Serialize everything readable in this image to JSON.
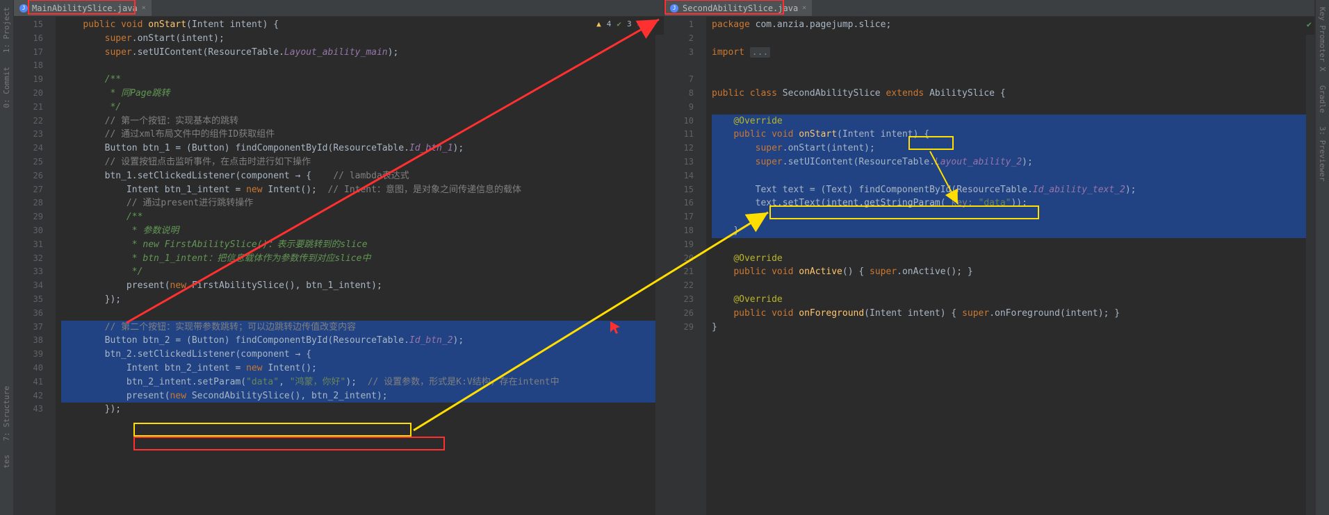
{
  "sidebar_left": {
    "project": "1: Project",
    "commit": "0: Commit"
  },
  "sidebar_left2": {
    "structure": "7: Structure",
    "tes": "tes"
  },
  "sidebar_right": {
    "keypromoter": "Key Promoter X",
    "gradle": "Gradle",
    "previewer": "3: Previewer"
  },
  "left_tab": "MainAbilitySlice.java",
  "right_tab": "SecondAbilitySlice.java",
  "inspections": {
    "warn": "4",
    "weak": "3"
  },
  "left_start_line": 15,
  "left_lines": [
    {
      "t": "    public void onStart(Intent intent) {",
      "tok": [
        [
          "    ",
          ""
        ],
        [
          "public",
          "kw"
        ],
        [
          " ",
          ""
        ],
        [
          "void",
          "kw"
        ],
        [
          " ",
          ""
        ],
        [
          "onStart",
          "mth"
        ],
        [
          "(Intent intent) {",
          ""
        ]
      ]
    },
    {
      "t": "        super.onStart(intent);",
      "tok": [
        [
          "        ",
          ""
        ],
        [
          "super",
          "kw"
        ],
        [
          ".onStart(intent);",
          ""
        ]
      ]
    },
    {
      "t": "        super.setUIContent(ResourceTable.Layout_ability_main);",
      "tok": [
        [
          "        ",
          ""
        ],
        [
          "super",
          "kw"
        ],
        [
          ".setUIContent(ResourceTable.",
          ""
        ],
        [
          "Layout_ability_main",
          "field"
        ],
        [
          ");",
          ""
        ]
      ]
    },
    {
      "t": ""
    },
    {
      "t": "        /**",
      "tok": [
        [
          "        ",
          ""
        ],
        [
          "/**",
          "doc"
        ]
      ]
    },
    {
      "t": "         * 同Page跳转",
      "tok": [
        [
          "         * 同Page跳转",
          "doc"
        ]
      ]
    },
    {
      "t": "         */",
      "tok": [
        [
          "         */",
          "doc"
        ]
      ]
    },
    {
      "t": "        // 第一个按钮：实现基本的跳转",
      "tok": [
        [
          "        ",
          ""
        ],
        [
          "// 第一个按钮：实现基本的跳转",
          "cmt"
        ]
      ]
    },
    {
      "t": "        // 通过xml布局文件中的组件ID获取组件",
      "tok": [
        [
          "        ",
          ""
        ],
        [
          "// 通过xml布局文件中的组件ID获取组件",
          "cmt"
        ]
      ]
    },
    {
      "t": "        Button btn_1 = (Button) findComponentById(ResourceTable.Id_btn_1);",
      "tok": [
        [
          "        Button btn_1 = (Button) findComponentById(ResourceTable.",
          ""
        ],
        [
          "Id_btn_1",
          "field"
        ],
        [
          ");",
          ""
        ]
      ]
    },
    {
      "t": "        // 设置按钮点击监听事件，在点击时进行如下操作",
      "tok": [
        [
          "        ",
          ""
        ],
        [
          "// 设置按钮点击监听事件，在点击时进行如下操作",
          "cmt"
        ]
      ]
    },
    {
      "t": "        btn_1.setClickedListener(component → {    // lambda表达式",
      "tok": [
        [
          "        btn_1.setClickedListener(component → {    ",
          ""
        ],
        [
          "// lambda表达式",
          "cmt"
        ]
      ]
    },
    {
      "t": "            Intent btn_1_intent = new Intent();  // Intent：意图，是对象之间传递信息的载体",
      "tok": [
        [
          "            Intent btn_1_intent = ",
          ""
        ],
        [
          "new",
          "kw"
        ],
        [
          " Intent();  ",
          ""
        ],
        [
          "// Intent：意图，是对象之间传递信息的载体",
          "cmt"
        ]
      ]
    },
    {
      "t": "            // 通过present进行跳转操作",
      "tok": [
        [
          "            ",
          ""
        ],
        [
          "// 通过present进行跳转操作",
          "cmt"
        ]
      ]
    },
    {
      "t": "            /**",
      "tok": [
        [
          "            ",
          ""
        ],
        [
          "/**",
          "doc"
        ]
      ]
    },
    {
      "t": "             * 参数说明",
      "tok": [
        [
          "             * 参数说明",
          "doc"
        ]
      ]
    },
    {
      "t": "             * new FirstAbilitySlice()：表示要跳转到的slice",
      "tok": [
        [
          "             * new FirstAbilitySlice()：表示要跳转到的slice",
          "doc"
        ]
      ]
    },
    {
      "t": "             * btn_1_intent：把信息载体作为参数传到对应slice中",
      "tok": [
        [
          "             * btn_1_intent：把信息载体作为参数传到对应slice中",
          "doc"
        ]
      ]
    },
    {
      "t": "             */",
      "tok": [
        [
          "             */",
          "doc"
        ]
      ]
    },
    {
      "t": "            present(new FirstAbilitySlice(), btn_1_intent);",
      "tok": [
        [
          "            present(",
          ""
        ],
        [
          "new",
          "kw"
        ],
        [
          " FirstAbilitySlice(), btn_1_intent);",
          ""
        ]
      ]
    },
    {
      "t": "        });",
      "tok": [
        [
          "        });",
          ""
        ]
      ]
    },
    {
      "t": ""
    },
    {
      "t": "        // 第二个按钮：实现带参数跳转；可以边跳转边传值改变内容",
      "tok": [
        [
          "        ",
          ""
        ],
        [
          "// 第二个按钮：实现带参数跳转；可以边跳转边传值改变内容",
          "cmt"
        ]
      ],
      "sel": true
    },
    {
      "t": "        Button btn_2 = (Button) findComponentById(ResourceTable.Id_btn_2);",
      "tok": [
        [
          "        Button btn_2 = (Button) findComponentById(ResourceTable.",
          ""
        ],
        [
          "Id_btn_2",
          "field"
        ],
        [
          ");",
          ""
        ]
      ],
      "sel": true
    },
    {
      "t": "        btn_2.setClickedListener(component → {",
      "tok": [
        [
          "        btn_2.setClickedListener(component → {",
          ""
        ]
      ],
      "sel": true
    },
    {
      "t": "            Intent btn_2_intent = new Intent();",
      "tok": [
        [
          "            Intent btn_2_intent = ",
          ""
        ],
        [
          "new",
          "kw"
        ],
        [
          " Intent();",
          ""
        ]
      ],
      "sel": true,
      "caret": true
    },
    {
      "t": "            btn_2_intent.setParam(\"data\", \"鸿蒙，你好\");  // 设置参数，形式是K:V结构，存在intent中",
      "tok": [
        [
          "            btn_2_intent.setParam(",
          ""
        ],
        [
          "\"data\"",
          "str"
        ],
        [
          ", ",
          ""
        ],
        [
          "\"鸿蒙，你好\"",
          "str"
        ],
        [
          ");  ",
          ""
        ],
        [
          "// 设置参数，形式是K:V结构，存在intent中",
          "cmt"
        ]
      ],
      "sel": true
    },
    {
      "t": "            present(new SecondAbilitySlice(), btn_2_intent);",
      "tok": [
        [
          "            present(",
          ""
        ],
        [
          "new",
          "kw"
        ],
        [
          " SecondAbilitySlice(), btn_2_intent);",
          ""
        ]
      ],
      "sel": true
    },
    {
      "t": "        });",
      "tok": [
        [
          "        });",
          ""
        ]
      ]
    }
  ],
  "right_start_line": 1,
  "right_lines": [
    {
      "n": 1,
      "t": "package com.anzia.pagejump.slice;",
      "tok": [
        [
          "package",
          "kw"
        ],
        [
          " com.anzia.pagejump.slice;",
          ""
        ]
      ]
    },
    {
      "n": 2,
      "t": ""
    },
    {
      "n": 3,
      "t": "import ...",
      "tok": [
        [
          "import",
          "kw"
        ],
        [
          " ",
          ""
        ],
        [
          "...",
          "dots"
        ]
      ]
    },
    {
      "blank": true
    },
    {
      "n": 7,
      "t": ""
    },
    {
      "n": 8,
      "t": "public class SecondAbilitySlice extends AbilitySlice {",
      "tok": [
        [
          "public class",
          "kw"
        ],
        [
          " SecondAbilitySlice ",
          ""
        ],
        [
          "extends",
          "kw"
        ],
        [
          " AbilitySlice {",
          ""
        ]
      ]
    },
    {
      "n": 9,
      "t": ""
    },
    {
      "n": 10,
      "t": "    @Override",
      "tok": [
        [
          "    ",
          ""
        ],
        [
          "@Override",
          "ann"
        ]
      ],
      "sel": true
    },
    {
      "n": 11,
      "t": "    public void onStart(Intent intent) {",
      "tok": [
        [
          "    ",
          ""
        ],
        [
          "public",
          "kw"
        ],
        [
          " ",
          ""
        ],
        [
          "void",
          "kw"
        ],
        [
          " ",
          ""
        ],
        [
          "onStart",
          "mth"
        ],
        [
          "(Intent intent) {",
          ""
        ]
      ],
      "sel": true
    },
    {
      "n": 12,
      "t": "        super.onStart(intent);",
      "tok": [
        [
          "        ",
          ""
        ],
        [
          "super",
          "kw"
        ],
        [
          ".onStart(intent);",
          ""
        ]
      ],
      "sel": true
    },
    {
      "n": 13,
      "t": "        super.setUIContent(ResourceTable.Layout_ability_2);",
      "tok": [
        [
          "        ",
          ""
        ],
        [
          "super",
          "kw"
        ],
        [
          ".setUIContent(ResourceTable.",
          ""
        ],
        [
          "Layout_ability_2",
          "field"
        ],
        [
          ");",
          ""
        ]
      ],
      "sel": true
    },
    {
      "n": 14,
      "t": "",
      "sel": true
    },
    {
      "n": 15,
      "t": "        Text text = (Text) findComponentById(ResourceTable.Id_ability_text_2);",
      "tok": [
        [
          "        Text text = (Text) findComponentById(ResourceTable.",
          ""
        ],
        [
          "Id_ability_text_2",
          "field"
        ],
        [
          ");",
          ""
        ]
      ],
      "sel": true
    },
    {
      "n": 16,
      "t": "        text.setText(intent.getStringParam( key: \"data\"));",
      "tok": [
        [
          "        text.setText(intent.getStringParam( ",
          ""
        ],
        [
          "key: ",
          "cmt"
        ],
        [
          "\"data\"",
          "str"
        ],
        [
          "));",
          ""
        ]
      ],
      "sel": true
    },
    {
      "n": 17,
      "t": "",
      "sel": true
    },
    {
      "n": 18,
      "t": "    }",
      "sel": true
    },
    {
      "n": 19,
      "t": ""
    },
    {
      "n": 20,
      "t": "    @Override",
      "tok": [
        [
          "    ",
          ""
        ],
        [
          "@Override",
          "ann"
        ]
      ]
    },
    {
      "n": 21,
      "t": "    public void onActive() { super.onActive(); }",
      "tok": [
        [
          "    ",
          ""
        ],
        [
          "public",
          "kw"
        ],
        [
          " ",
          ""
        ],
        [
          "void",
          "kw"
        ],
        [
          " ",
          ""
        ],
        [
          "onActive",
          "mth"
        ],
        [
          "() { ",
          ""
        ],
        [
          "super",
          "kw"
        ],
        [
          ".onActive(); }",
          ""
        ]
      ]
    },
    {
      "n": 22,
      "t": ""
    },
    {
      "n": 23,
      "t": "    @Override",
      "tok": [
        [
          "    ",
          ""
        ],
        [
          "@Override",
          "ann"
        ]
      ]
    },
    {
      "n": 26,
      "t": "    public void onForeground(Intent intent) { super.onForeground(intent); }",
      "tok": [
        [
          "    ",
          ""
        ],
        [
          "public",
          "kw"
        ],
        [
          " ",
          ""
        ],
        [
          "void",
          "kw"
        ],
        [
          " ",
          ""
        ],
        [
          "onForeground",
          "mth"
        ],
        [
          "(Intent intent) { ",
          ""
        ],
        [
          "super",
          "kw"
        ],
        [
          ".onForeground(intent); }",
          ""
        ]
      ]
    },
    {
      "n": 29,
      "t": "}"
    },
    {
      "blank": true
    }
  ]
}
